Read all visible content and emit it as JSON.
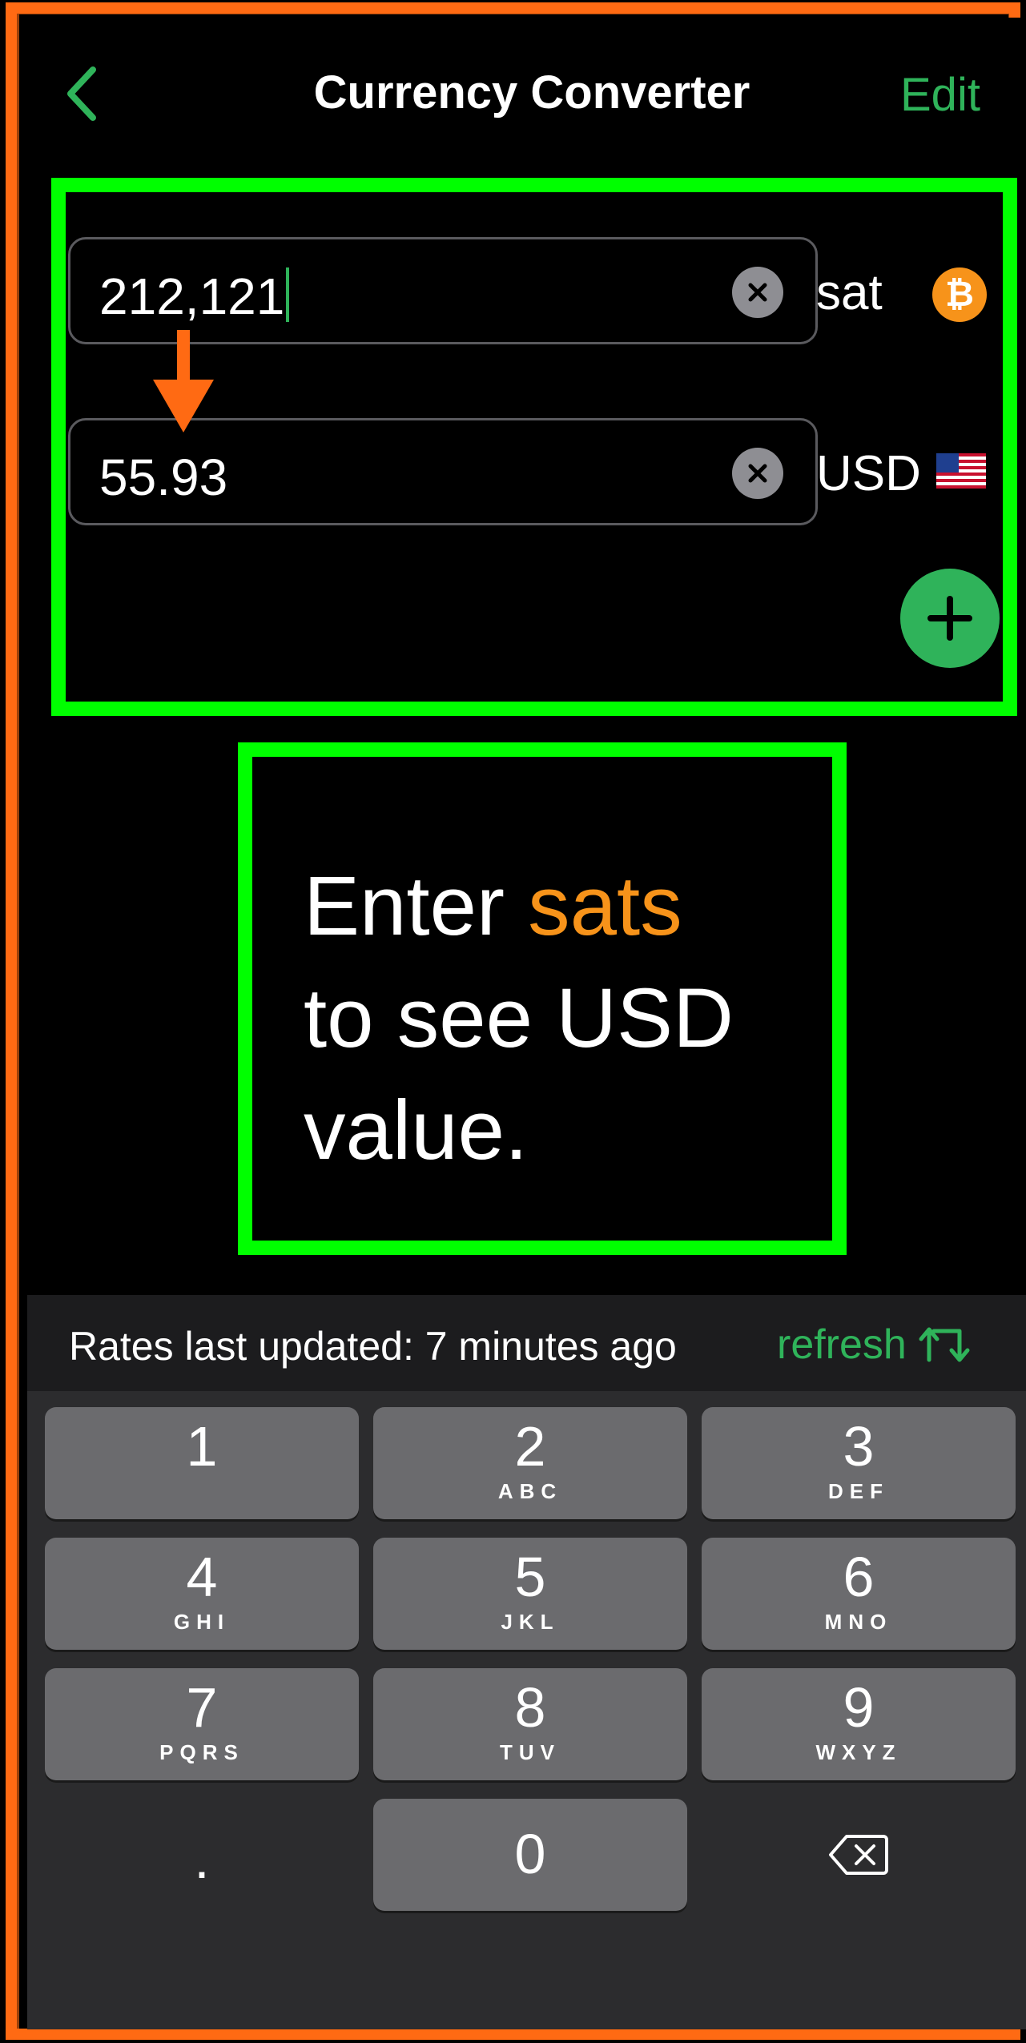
{
  "nav": {
    "title": "Currency Converter",
    "edit_label": "Edit"
  },
  "inputs": [
    {
      "value": "212,121",
      "unit": "sat",
      "icon": "bitcoin-icon"
    },
    {
      "value": "55.93",
      "unit": "USD",
      "icon": "us-flag-icon"
    }
  ],
  "annotation": {
    "line1_prefix": "Enter ",
    "line1_highlight": "sats",
    "line2": "to see USD",
    "line3": "value."
  },
  "rates": {
    "status": "Rates last updated: 7 minutes ago",
    "refresh_label": "refresh"
  },
  "keypad": {
    "keys": [
      {
        "num": "1",
        "letters": ""
      },
      {
        "num": "2",
        "letters": "ABC"
      },
      {
        "num": "3",
        "letters": "DEF"
      },
      {
        "num": "4",
        "letters": "GHI"
      },
      {
        "num": "5",
        "letters": "JKL"
      },
      {
        "num": "6",
        "letters": "MNO"
      },
      {
        "num": "7",
        "letters": "PQRS"
      },
      {
        "num": "8",
        "letters": "TUV"
      },
      {
        "num": "9",
        "letters": "WXYZ"
      },
      {
        "num": ".",
        "letters": ""
      },
      {
        "num": "0",
        "letters": ""
      }
    ]
  },
  "colors": {
    "accent": "#2fb35a",
    "annotation": "#00ff00",
    "bitcoin": "#f7931a",
    "frame": "#ff6a13"
  }
}
